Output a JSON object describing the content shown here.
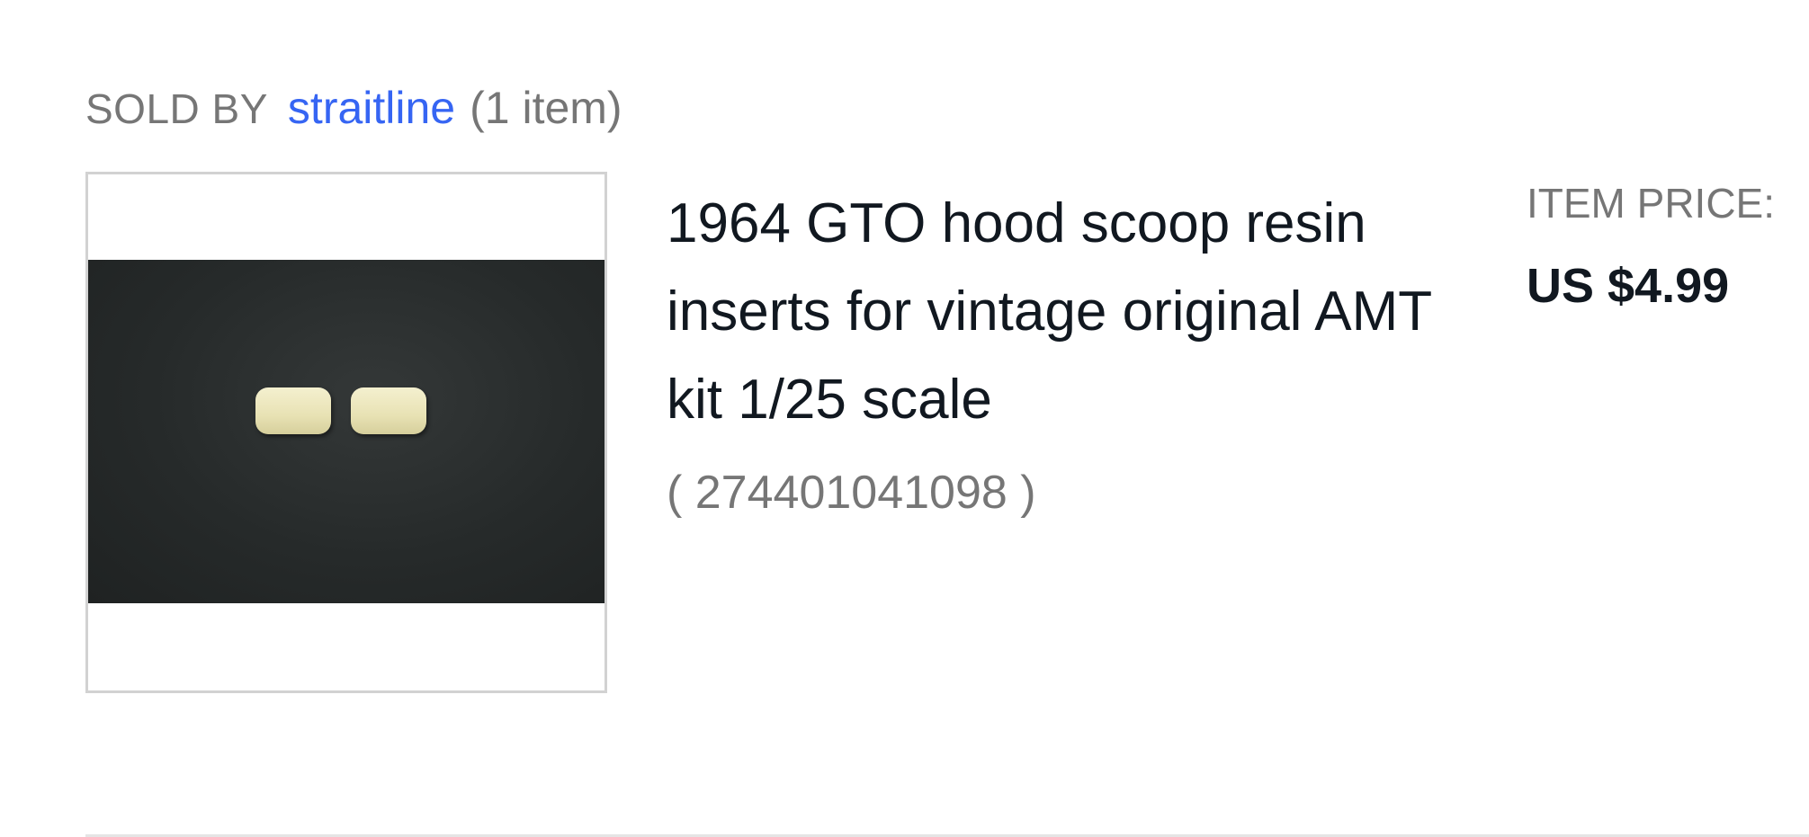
{
  "seller": {
    "sold_by_label": "SOLD BY",
    "name": "straitline",
    "item_count": "(1 item)"
  },
  "item": {
    "title": "1964 GTO hood scoop resin inserts for vintage original AMT kit 1/25 scale",
    "item_number": "( 274401041098 )",
    "price_label": "ITEM PRICE:",
    "price": "US $4.99",
    "thumbnail_icon": "product-photo"
  },
  "colors": {
    "link": "#3665f3",
    "muted_text": "#767676",
    "primary_text": "#111820"
  }
}
